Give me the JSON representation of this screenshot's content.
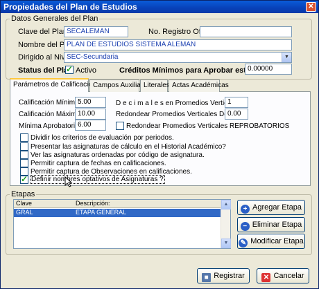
{
  "window": {
    "title": "Propiedades del Plan de Estudios",
    "close_glyph": "✕"
  },
  "datos_generales": {
    "legend": "Datos Generales del Plan",
    "clave_label": "Clave del Plan",
    "clave_value": "SECALEMAN",
    "registro_label": "No. Registro Oficial",
    "registro_value": "",
    "nombre_label": "Nombre del Plan",
    "nombre_value": "PLAN DE ESTUDIOS SISTEMA ALEMAN",
    "dirigido_label": "Dirigido al Nivel",
    "dirigido_value": "SEC-Secundaria",
    "status_label": "Status del Plan",
    "activo_label": "Activo",
    "activo_checked": true,
    "creditos_label": "Créditos Mínimos para Aprobar este Plan",
    "creditos_value": "0.00000"
  },
  "tabs": [
    {
      "label": "Parámetros de Calificaciones",
      "active": true
    },
    {
      "label": "Campos Auxiliares",
      "active": false
    },
    {
      "label": "Literales",
      "active": false
    },
    {
      "label": "Actas Académicas",
      "active": false
    }
  ],
  "parametros": {
    "cal_minima_label": "Calificación Mínima",
    "cal_minima_value": "5.00",
    "cal_maxima_label": "Calificación Máxima",
    "cal_maxima_value": "10.00",
    "min_aprob_label": "Mínima Aprobatoria",
    "min_aprob_value": "6.00",
    "decimales_label": "D e c i m a l e s  en Promedios Verticales",
    "decimales_value": "1",
    "redondear_label": "Redondear Promedios Verticales Desde",
    "redondear_value": "0.00",
    "redondear_reprob_label": "Redondear Promedios Verticales REPROBATORIOS",
    "options": [
      {
        "label": "Dividir los criterios de evaluación por periodos.",
        "checked": false
      },
      {
        "label": "Presentar las asignaturas de cálculo en el Historial Académico?",
        "checked": false
      },
      {
        "label": "Ver las asignaturas ordenadas por código de asignatura.",
        "checked": false
      },
      {
        "label": "Permitir captura de fechas en calificaciones.",
        "checked": false
      },
      {
        "label": "Permitir captura de Observaciones en calificaciones.",
        "checked": false
      },
      {
        "label": "Definir nombres optativos de Asignaturas ?",
        "checked": true
      }
    ]
  },
  "etapas": {
    "legend": "Etapas",
    "columns": [
      "Clave",
      "Descripción:"
    ],
    "rows": [
      {
        "clave": "GRAL",
        "descripcion": "ETAPA GENERAL"
      }
    ],
    "agregar": "Agregar Etapa",
    "eliminar": "Eliminar Etapa",
    "modificar": "Modificar Etapa"
  },
  "footer": {
    "registrar": "Registrar",
    "cancelar": "Cancelar"
  }
}
